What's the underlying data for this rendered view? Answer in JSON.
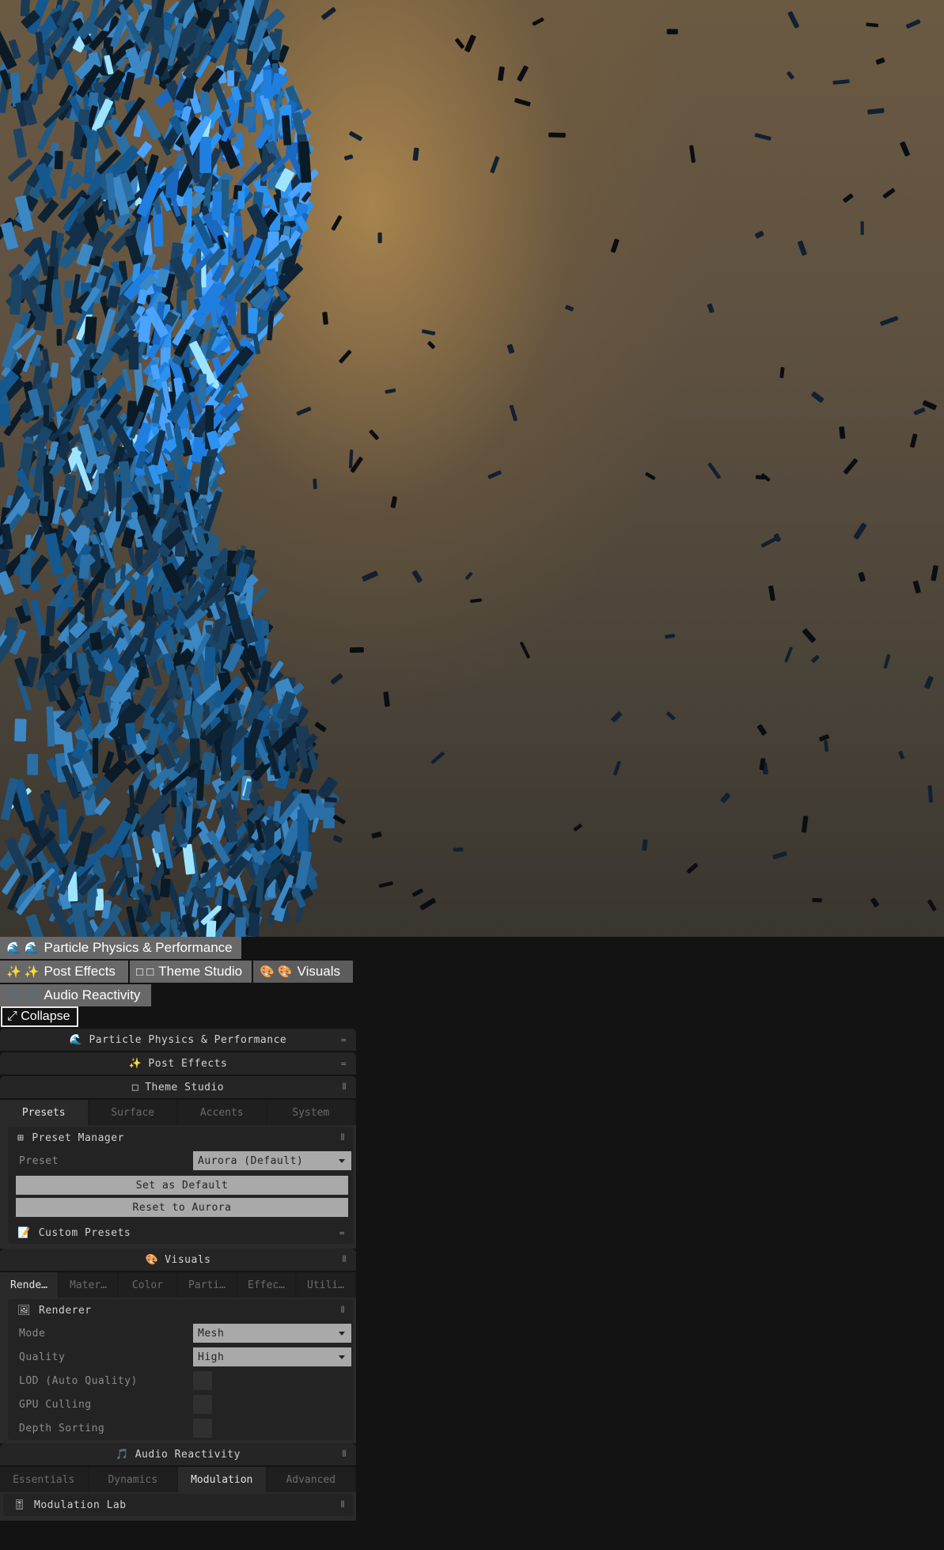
{
  "scene": {
    "background_accent": "#4aa3ff"
  },
  "tabbar": {
    "chips": [
      {
        "icon": "🌊 🌊",
        "label": "Particle Physics & Performance"
      },
      {
        "icon": "✨ ✨",
        "label": "Post Effects"
      },
      {
        "icon": "□ □",
        "label": "Theme Studio"
      },
      {
        "icon": "🎨 🎨",
        "label": "Visuals"
      },
      {
        "icon": "🎵 🎵",
        "label": "Audio Reactivity"
      }
    ],
    "collapse_label": "⤢ Collapse"
  },
  "panel": {
    "sections": {
      "physics": {
        "icon": "🌊",
        "label": "Particle Physics & Performance",
        "toggle": "="
      },
      "post": {
        "icon": "✨",
        "label": "Post Effects",
        "toggle": "="
      },
      "theme": {
        "icon": "□",
        "label": "Theme Studio",
        "toggle": "⦀"
      },
      "visuals": {
        "icon": "🎨",
        "label": "Visuals",
        "toggle": "⦀"
      },
      "audio": {
        "icon": "🎵",
        "label": "Audio Reactivity",
        "toggle": "⦀"
      }
    },
    "theme_tabs": [
      "Presets",
      "Surface",
      "Accents",
      "System"
    ],
    "preset_manager": {
      "icon": "⊞",
      "title": "Preset Manager",
      "toggle": "⦀",
      "preset_label": "Preset",
      "preset_value": "Aurora (Default)",
      "set_default": "Set as Default",
      "reset": "Reset to Aurora"
    },
    "custom_presets": {
      "icon": "📝",
      "title": "Custom Presets",
      "toggle": "="
    },
    "visuals_tabs": [
      "Rende…",
      "Mater…",
      "Color",
      "Parti…",
      "Effec…",
      "Utili…"
    ],
    "renderer": {
      "icon": "🖼",
      "title": "Renderer",
      "toggle": "⦀",
      "mode_label": "Mode",
      "mode_value": "Mesh",
      "quality_label": "Quality",
      "quality_value": "High",
      "lod_label": "LOD (Auto Quality)",
      "gpu_label": "GPU Culling",
      "depth_label": "Depth Sorting"
    },
    "audio_tabs": [
      "Essentials",
      "Dynamics",
      "Modulation",
      "Advanced"
    ],
    "modulation_lab": {
      "icon": "🎚",
      "title": "Modulation Lab",
      "toggle": "⦀"
    }
  }
}
